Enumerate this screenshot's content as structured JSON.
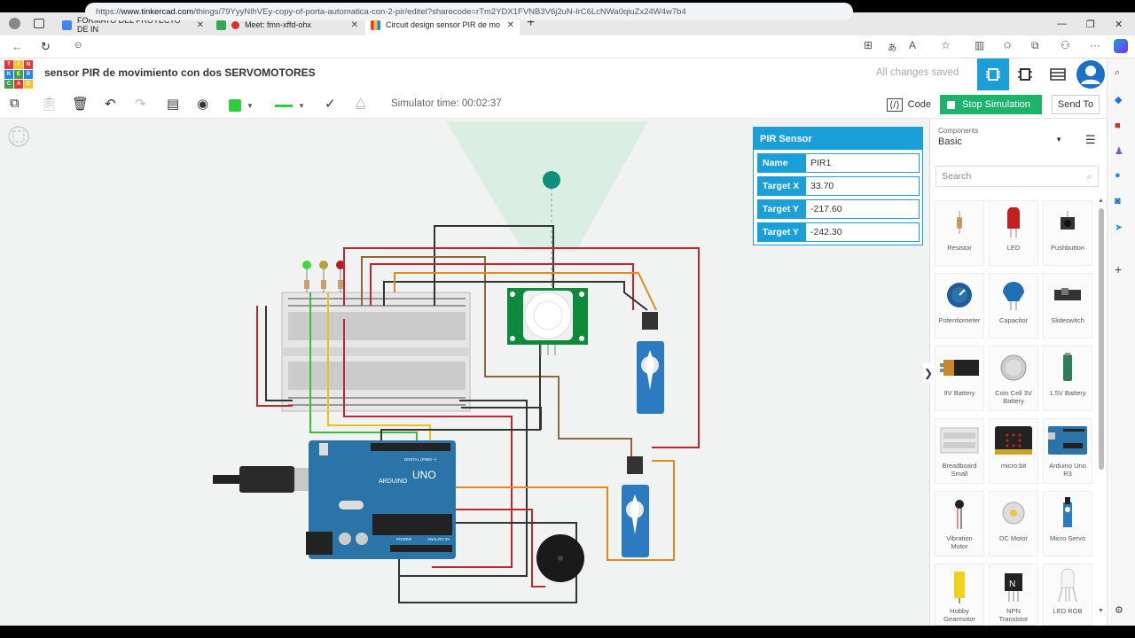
{
  "browser": {
    "tabs": [
      {
        "title": "FORMATO DEL PROYECTO DE IN"
      },
      {
        "title": "Meet: fmn-xffd-ohx"
      },
      {
        "title": "Circuit design sensor PIR de mo"
      }
    ],
    "url_prefix": "https://",
    "url_domain": "www.tinkercad.com",
    "url_path": "/things/79YyyNlhVEy-copy-of-porta-automatica-con-2-pir/editel?sharecode=rTm2YDX1FVNB3V6j2uN-IrC6LcNWa0qiuZx24W4w7b4"
  },
  "app": {
    "logo_letters": [
      "TIN",
      "KER",
      "CAD"
    ],
    "project_title": "sensor PIR de movimiento con dos SERVOMOTORES",
    "save_status": "All changes saved"
  },
  "toolbar": {
    "simulator_time": "Simulator time: 00:02:37",
    "code_label": "Code",
    "stop_label": "Stop Simulation",
    "send_label": "Send To"
  },
  "inspector": {
    "title": "PIR Sensor",
    "fields": [
      {
        "key": "Name",
        "value": "PIR1"
      },
      {
        "key": "Target X",
        "value": "33.70"
      },
      {
        "key": "Target Y",
        "value": "-217.60"
      },
      {
        "key": "Target Y",
        "value": "-242.30"
      }
    ]
  },
  "components": {
    "selector_label": "Components",
    "selector_value": "Basic",
    "search_placeholder": "Search",
    "items": [
      {
        "label": "Resistor",
        "icon": "resistor-icon"
      },
      {
        "label": "LED",
        "icon": "led-icon"
      },
      {
        "label": "Pushbutton",
        "icon": "pushbutton-icon"
      },
      {
        "label": "Potentiometer",
        "icon": "potentiometer-icon"
      },
      {
        "label": "Capacitor",
        "icon": "capacitor-icon"
      },
      {
        "label": "Slideswitch",
        "icon": "slideswitch-icon"
      },
      {
        "label": "9V Battery",
        "icon": "battery-9v-icon"
      },
      {
        "label": "Coin Cell 3V Battery",
        "icon": "coin-cell-icon"
      },
      {
        "label": "1.5V Battery",
        "icon": "battery-aa-icon"
      },
      {
        "label": "Breadboard Small",
        "icon": "breadboard-icon"
      },
      {
        "label": "micro:bit",
        "icon": "microbit-icon"
      },
      {
        "label": "Arduino Uno R3",
        "icon": "arduino-icon"
      },
      {
        "label": "Vibration Motor",
        "icon": "vibration-motor-icon"
      },
      {
        "label": "DC Motor",
        "icon": "dc-motor-icon"
      },
      {
        "label": "Micro Servo",
        "icon": "micro-servo-icon"
      },
      {
        "label": "Hobby Gearmotor",
        "icon": "gearmotor-icon"
      },
      {
        "label": "NPN Transistor",
        "icon": "npn-transistor-icon"
      },
      {
        "label": "LED RGB",
        "icon": "led-rgb-icon"
      }
    ]
  },
  "circuit": {
    "arduino_label": "UNO",
    "arduino_brand": "ARDUINO",
    "digital_label": "DIGITAL (PWM ~)",
    "power_label": "POWER",
    "analog_label": "ANALOG IN"
  },
  "colors": {
    "accent": "#1a9fd8",
    "stop_green": "#1fb26a",
    "arduino_blue": "#2b74a8",
    "pir_green": "#0e8a3c"
  }
}
